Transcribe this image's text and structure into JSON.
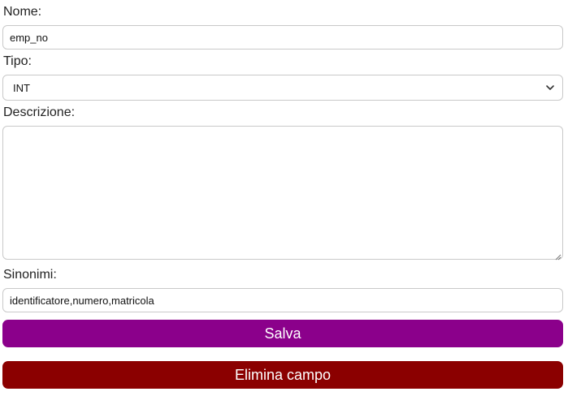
{
  "form": {
    "name_label": "Nome:",
    "name_value": "emp_no",
    "type_label": "Tipo:",
    "type_selected": "INT",
    "description_label": "Descrizione:",
    "description_value": "",
    "synonyms_label": "Sinonimi:",
    "synonyms_value": "identificatore,numero,matricola"
  },
  "buttons": {
    "save_label": "Salva",
    "delete_label": "Elimina campo"
  },
  "colors": {
    "save_bg": "#8b008b",
    "delete_bg": "#8b0000"
  },
  "icons": {
    "select_arrow": "chevron-down-icon",
    "textarea_grip": "resize-grip-icon"
  }
}
